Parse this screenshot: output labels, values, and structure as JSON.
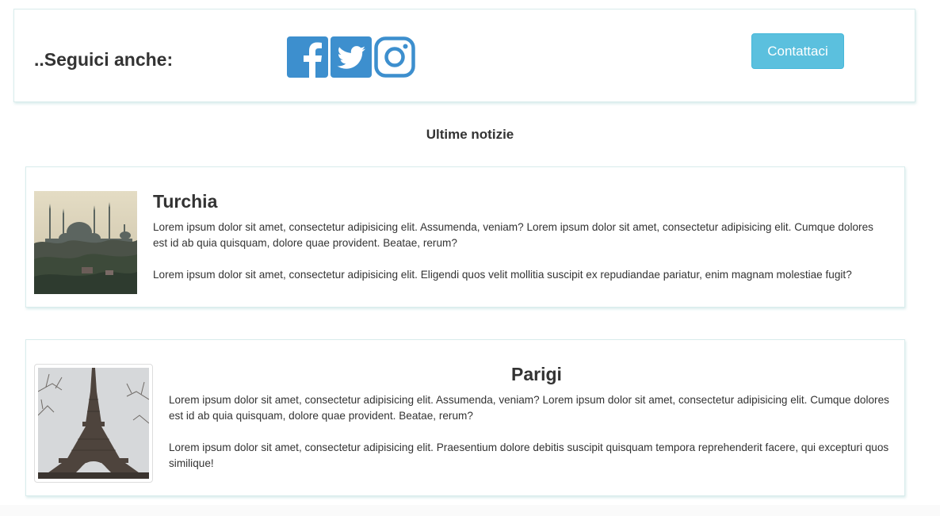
{
  "follow": {
    "label": "..Seguici anche:",
    "social": [
      {
        "icon": "facebook-icon",
        "color": "#3d8fce"
      },
      {
        "icon": "twitter-icon",
        "color": "#3d8fce"
      },
      {
        "icon": "instagram-icon",
        "color": "#3d8fce"
      }
    ],
    "contact_label": "Contattaci"
  },
  "news": {
    "heading": "Ultime notizie",
    "items": [
      {
        "title": "Turchia",
        "paragraph1": "Lorem ipsum dolor sit amet, consectetur adipisicing elit. Assumenda, veniam? Lorem ipsum dolor sit amet, consectetur adipisicing elit. Cumque dolores est id ab quia quisquam, dolore quae provident. Beatae, rerum?",
        "paragraph2": "Lorem ipsum dolor sit amet, consectetur adipisicing elit. Eligendi quos velit mollitia suscipit ex repudiandae pariatur, enim magnam molestiae fugit?",
        "image": "istanbul-mosque-photo"
      },
      {
        "title": "Parigi",
        "paragraph1": "Lorem ipsum dolor sit amet, consectetur adipisicing elit. Assumenda, veniam? Lorem ipsum dolor sit amet, consectetur adipisicing elit. Cumque dolores est id ab quia quisquam, dolore quae provident. Beatae, rerum?",
        "paragraph2": "Lorem ipsum dolor sit amet, consectetur adipisicing elit. Praesentium dolore debitis suscipit quisquam tempora reprehenderit facere, qui excepturi quos similique!",
        "image": "eiffel-tower-photo"
      }
    ]
  },
  "colors": {
    "accent": "#5bc0de",
    "social_blue": "#3d8fce",
    "border": "#d9ecec"
  }
}
